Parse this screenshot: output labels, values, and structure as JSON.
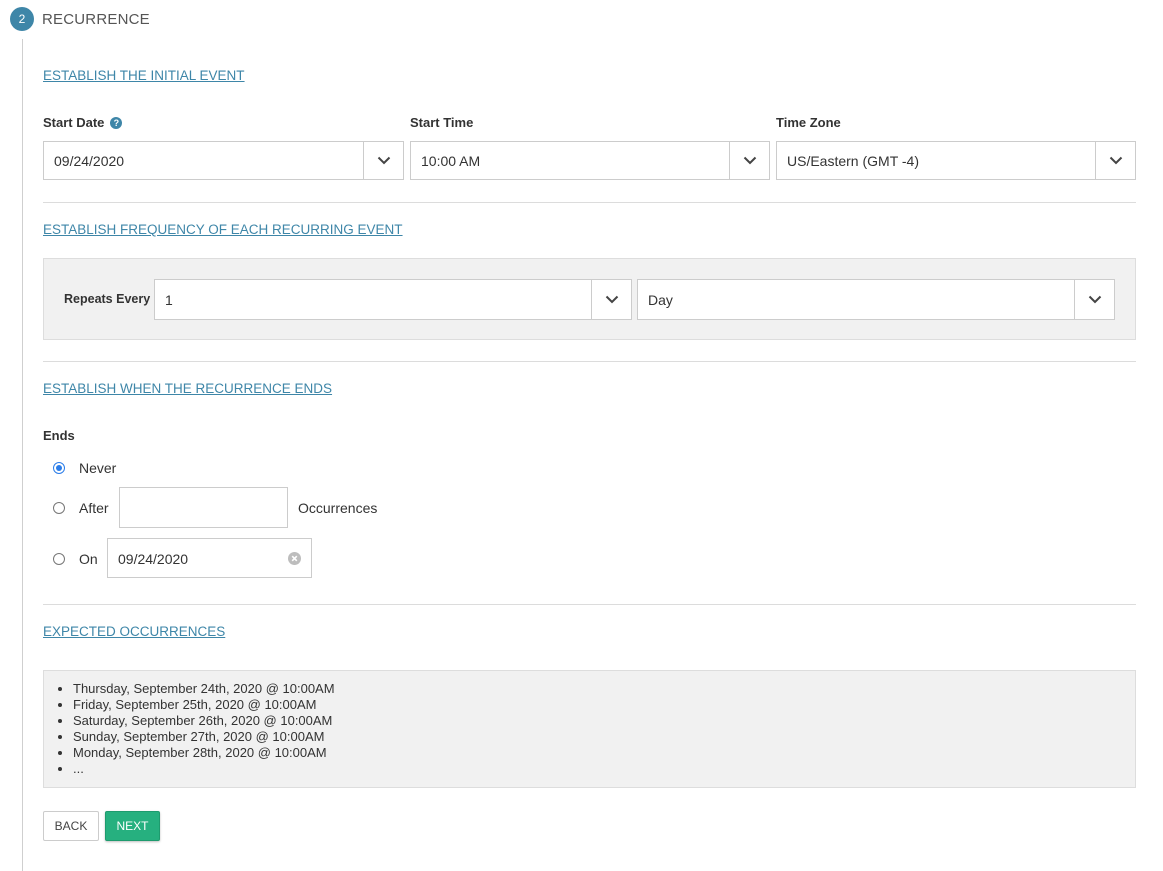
{
  "step": {
    "number": "2",
    "title": "RECURRENCE"
  },
  "initial_event": {
    "heading": "ESTABLISH THE INITIAL EVENT",
    "start_date": {
      "label": "Start Date",
      "value": "09/24/2020"
    },
    "start_time": {
      "label": "Start Time",
      "value": "10:00 AM"
    },
    "time_zone": {
      "label": "Time Zone",
      "value": "US/Eastern (GMT -4)"
    }
  },
  "frequency": {
    "heading": "ESTABLISH FREQUENCY OF EACH RECURRING EVENT",
    "repeats_label": "Repeats Every",
    "interval_value": "1",
    "unit_value": "Day"
  },
  "ends": {
    "heading": "ESTABLISH WHEN THE RECURRENCE ENDS",
    "label": "Ends",
    "options": {
      "never": "Never",
      "after": "After",
      "after_suffix": "Occurrences",
      "on": "On"
    },
    "selected": "never",
    "after_value": "",
    "on_value": "09/24/2020"
  },
  "expected": {
    "heading": "EXPECTED OCCURRENCES",
    "items": [
      "Thursday, September 24th, 2020 @ 10:00AM",
      "Friday, September 25th, 2020 @ 10:00AM",
      "Saturday, September 26th, 2020 @ 10:00AM",
      "Sunday, September 27th, 2020 @ 10:00AM",
      "Monday, September 28th, 2020 @ 10:00AM",
      "..."
    ]
  },
  "buttons": {
    "back": "BACK",
    "next": "NEXT"
  },
  "colors": {
    "accent": "#3e86a8",
    "primary_button": "#26b07f",
    "radio_selected": "#2b7de9"
  }
}
